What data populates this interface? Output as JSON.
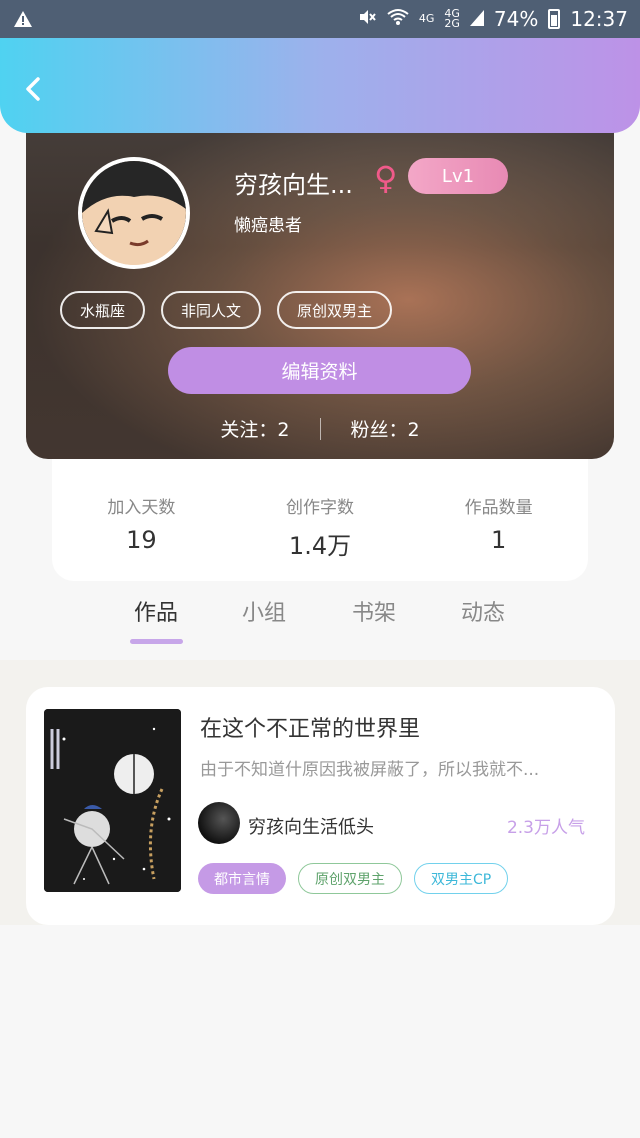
{
  "status_bar": {
    "network_top": "4G",
    "network_mid": "4G",
    "network_bottom": "2G",
    "battery": "74%",
    "time": "12:37"
  },
  "profile": {
    "nickname": "穷孩向生...",
    "gender_symbol": "♀",
    "level": "Lv1",
    "signature": "懒癌患者",
    "tags": [
      "水瓶座",
      "非同人文",
      "原创双男主"
    ],
    "edit_label": "编辑资料",
    "following": "关注：2",
    "followers": "粉丝：2"
  },
  "stats": [
    {
      "label": "加入天数",
      "value": "19"
    },
    {
      "label": "创作字数",
      "value": "1.4万"
    },
    {
      "label": "作品数量",
      "value": "1"
    }
  ],
  "tabs": [
    "作品",
    "小组",
    "书架",
    "动态"
  ],
  "work": {
    "title": "在这个不正常的世界里",
    "description": "由于不知道什原因我被屏蔽了，所以我就不...",
    "author": "穷孩向生活低头",
    "popularity": "2.3万人气",
    "tags": [
      "都市言情",
      "原创双男主",
      "双男主CP"
    ]
  }
}
